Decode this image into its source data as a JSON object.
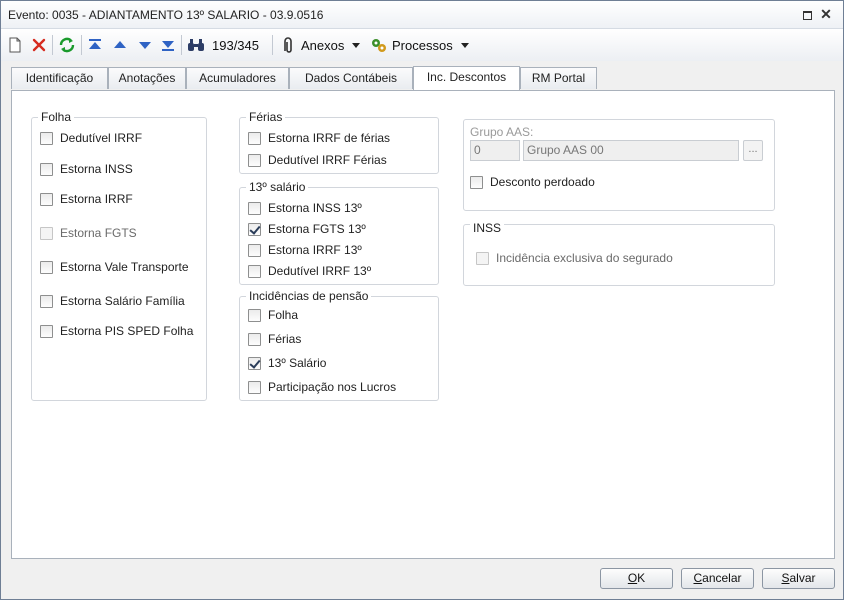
{
  "window": {
    "title": "Evento: 0035 - ADIANTAMENTO 13º SALARIO - 03.9.0516"
  },
  "toolbar": {
    "record_counter": "193/345",
    "attachments_label": "Anexos",
    "processes_label": "Processos"
  },
  "tabs": [
    {
      "label": "Identificação",
      "active": false
    },
    {
      "label": "Anotações",
      "active": false
    },
    {
      "label": "Acumuladores",
      "active": false
    },
    {
      "label": "Dados Contábeis",
      "active": false
    },
    {
      "label": "Inc. Descontos",
      "active": true
    },
    {
      "label": "RM Portal",
      "active": false
    }
  ],
  "folha": {
    "title": "Folha",
    "items": [
      {
        "label": "Dedutível IRRF",
        "checked": false,
        "enabled": true
      },
      {
        "label": "Estorna INSS",
        "checked": false,
        "enabled": true
      },
      {
        "label": "Estorna IRRF",
        "checked": false,
        "enabled": true
      },
      {
        "label": "Estorna FGTS",
        "checked": false,
        "enabled": false
      },
      {
        "label": "Estorna Vale Transporte",
        "checked": false,
        "enabled": true
      },
      {
        "label": "Estorna Salário Família",
        "checked": false,
        "enabled": true
      },
      {
        "label": "Estorna PIS SPED Folha",
        "checked": false,
        "enabled": true
      }
    ]
  },
  "ferias": {
    "title": "Férias",
    "items": [
      {
        "label": "Estorna IRRF de férias",
        "checked": false
      },
      {
        "label": "Dedutível IRRF Férias",
        "checked": false
      }
    ]
  },
  "decimo": {
    "title": "13º salário",
    "items": [
      {
        "label": "Estorna INSS 13º",
        "checked": false
      },
      {
        "label": "Estorna FGTS 13º",
        "checked": true
      },
      {
        "label": "Estorna IRRF 13º",
        "checked": false
      },
      {
        "label": "Dedutível IRRF 13º",
        "checked": false
      }
    ]
  },
  "pensao": {
    "title": "Incidências de pensão",
    "items": [
      {
        "label": "Folha",
        "checked": false
      },
      {
        "label": "Férias",
        "checked": false
      },
      {
        "label": "13º Salário",
        "checked": true
      },
      {
        "label": "Participação nos Lucros",
        "checked": false
      }
    ]
  },
  "aas": {
    "label": "Grupo AAS:",
    "code": "0",
    "name": "Grupo AAS 00",
    "ellipsis": "...",
    "desconto_label": "Desconto perdoado",
    "desconto_checked": false
  },
  "inss": {
    "title": "INSS",
    "item_label": "Incidência exclusiva do segurado",
    "checked": false
  },
  "footer": {
    "ok": "OK",
    "cancel": "Cancelar",
    "save": "Salvar"
  }
}
